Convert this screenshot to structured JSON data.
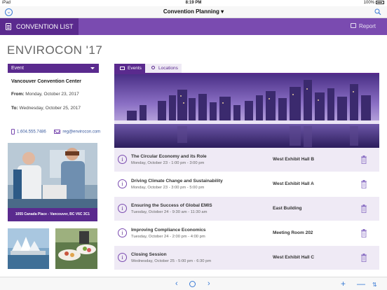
{
  "status": {
    "device": "iPad",
    "time": "8:19 PM",
    "battery": "100%"
  },
  "navbar": {
    "title": "Convention Planning ▾"
  },
  "header": {
    "list_label": "CONVENTION LIST",
    "report_label": "Report"
  },
  "event": {
    "title": "ENVIROCON '17",
    "select_value": "Event",
    "venue": "Vancouver Convention Center",
    "from_label": "From:",
    "from_date": "Monday, October 23, 2017",
    "to_label": "To:",
    "to_date": "Wednesday, October 25, 2017",
    "phone": "1.604.555.7486",
    "email": "reg@envirocon.com",
    "address": "1055 Canada Place - Vancouver, BC V6C 3C1"
  },
  "tabs": {
    "events": "Events",
    "locations": "Locations"
  },
  "sessions": [
    {
      "name": "The Circular Economy and its Role",
      "when": "Monday, October 23 - 1:00 pm - 3:00 pm",
      "location": "West Exhibit Hall B"
    },
    {
      "name": "Driving Climate Change and Sustainability",
      "when": "Monday, October 23 - 3:00 pm - 5:00 pm",
      "location": "West Exhibit Hall A"
    },
    {
      "name": "Ensuring the Success of Global EMIS",
      "when": "Tuesday, October 24 - 9:30 am - 11:30 am",
      "location": "East Building"
    },
    {
      "name": "Improving Compliance Economics",
      "when": "Tuesday, October 24 - 2:00 pm - 4:00 pm",
      "location": "Meeting Room 202"
    },
    {
      "name": "Closing Session",
      "when": "Wednesday, October 25 - 5:00 pm - 6:30 pm",
      "location": "West Exhibit Hall C"
    }
  ],
  "toolbar": {
    "prev": "‹",
    "next": "›",
    "plus": "+",
    "minus": "—",
    "sort": "⇅"
  },
  "colors": {
    "purple_dark": "#5a2a8e",
    "purple": "#7a4bb0",
    "row_tint": "#efeaf5",
    "ios_blue": "#3a7bd5"
  }
}
